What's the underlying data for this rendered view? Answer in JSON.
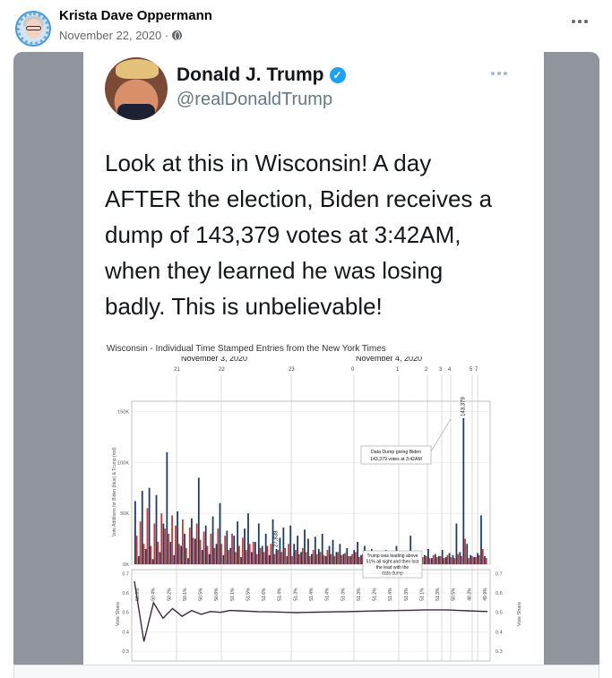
{
  "post": {
    "author": "Krista Dave Oppermann",
    "date": "November 22, 2020 ·"
  },
  "tweet": {
    "name": "Donald J. Trump",
    "handle": "@realDonaldTrump",
    "text_lines": [
      "Look at this in Wisconsin! A day",
      "AFTER the election, Biden receives a",
      "dump of 143,379 votes at 3:42AM,",
      "when they learned he was losing",
      "badly. This is unbelievable!"
    ]
  },
  "colors": {
    "biden": "#1f3a5f",
    "trump": "#c23b3b",
    "share_line": "#3b2a3e",
    "background_gray": "#90959d",
    "verified": "#1da1f2"
  },
  "chart_data": {
    "type": "bar",
    "title": "Wisconsin - Individual Time Stamped Entries from the New York Times",
    "dates": [
      "November 3, 2020",
      "November 4, 2020"
    ],
    "hour_ticks": [
      "21",
      "22",
      "23",
      "0",
      "1",
      "2",
      "3",
      "4",
      "5",
      "7"
    ],
    "upper_ylabel": "Vote Additions for Biden (blue) & Trump (red)",
    "upper_yticks": [
      "150K",
      "100K",
      "50K",
      "0K"
    ],
    "lower_ylabel": "Vote Share",
    "lower_yticks": [
      "0.7",
      "0.6",
      "0.5",
      "0.4",
      "0.3"
    ],
    "ylim_upper": [
      0,
      160000
    ],
    "ylim_lower": [
      0.25,
      0.72
    ],
    "biden_values": [
      62000,
      8000,
      72000,
      15000,
      75000,
      5000,
      68000,
      12000,
      40000,
      110000,
      22000,
      9000,
      52000,
      18000,
      30000,
      6000,
      45000,
      25000,
      85000,
      14000,
      38000,
      10000,
      47000,
      20000,
      60000,
      9000,
      33000,
      16000,
      28000,
      42000,
      7000,
      35000,
      50000,
      12000,
      22000,
      40000,
      18000,
      30000,
      9000,
      44000,
      15000,
      26000,
      36000,
      8000,
      38000,
      20000,
      28000,
      12000,
      34000,
      25000,
      10000,
      27000,
      15000,
      30000,
      8000,
      18000,
      24000,
      12000,
      20000,
      10000,
      16000,
      8000,
      14000,
      22000,
      9000,
      18000,
      12000,
      15000,
      7000,
      13000,
      10000,
      14000,
      6000,
      12000,
      18000,
      9000,
      11000,
      8000,
      28000,
      10000,
      7000,
      12000,
      9000,
      15000,
      6000,
      10000,
      8000,
      14000,
      7000,
      11000,
      9000,
      40000,
      12000,
      143379,
      20000,
      9000,
      7000,
      11000,
      48000,
      8000
    ],
    "trump_values": [
      28000,
      42000,
      20000,
      55000,
      18000,
      40000,
      22000,
      50000,
      35000,
      30000,
      48000,
      38000,
      20000,
      44000,
      16000,
      36000,
      26000,
      40000,
      24000,
      32000,
      18000,
      30000,
      16000,
      35000,
      20000,
      28000,
      14000,
      30000,
      12000,
      18000,
      26000,
      14000,
      20000,
      22000,
      10000,
      16000,
      12000,
      18000,
      20000,
      10000,
      14000,
      12000,
      16000,
      20000,
      8000,
      14000,
      10000,
      16000,
      12000,
      8000,
      14000,
      10000,
      12000,
      9000,
      14000,
      10000,
      8000,
      12000,
      9000,
      11000,
      8000,
      10000,
      12000,
      7000,
      10000,
      8000,
      9000,
      7000,
      10000,
      8000,
      9000,
      6000,
      10000,
      8000,
      6000,
      9000,
      7000,
      10000,
      8000,
      6000,
      9000,
      7000,
      8000,
      6000,
      9000,
      7000,
      8000,
      6000,
      9000,
      7000,
      6000,
      10000,
      8000,
      25000,
      6000,
      8000,
      7000,
      9000,
      15000,
      6000
    ],
    "bar_labels": [
      {
        "index": 40,
        "text": "27,838"
      },
      {
        "index": 93,
        "text": "143,379"
      }
    ],
    "vote_share": [
      0.66,
      0.35,
      0.55,
      0.47,
      0.52,
      0.48,
      0.51,
      0.49,
      0.505,
      0.5,
      0.51,
      0.508,
      0.506,
      0.504,
      0.503,
      0.502,
      0.5,
      0.499,
      0.5,
      0.501,
      0.502,
      0.503,
      0.504,
      0.505,
      0.506,
      0.507,
      0.508,
      0.509,
      0.51,
      0.511,
      0.512,
      0.513,
      0.513,
      0.512,
      0.51,
      0.508,
      0.506,
      0.505
    ],
    "share_labels": [
      "58.0%",
      "50.4%",
      "50.2%",
      "50.1%",
      "50.5%",
      "50.8%",
      "51.1%",
      "51.5%",
      "51.6%",
      "51.4%",
      "51.3%",
      "51.4%",
      "51.4%",
      "51.3%",
      "51.3%",
      "51.2%",
      "51.4%",
      "51.3%",
      "51.1%",
      "51.3%",
      "50.5%",
      "48.3%",
      "49.9%"
    ],
    "annotations": [
      "Data Dump giving Biden 143,379 votes at 3:42AM",
      "Trump was leading above 51% all night and then lost the lead with the data dump"
    ],
    "minute_ticks": "24 34 42 49 56 | 4 14 28 46 56 | 3 11 17 25 34 42 50 | 5 12 21 27 35 48 | 8 14 21 35 46 | 8 15 45 | 32 46 | 9",
    "grid": true
  }
}
